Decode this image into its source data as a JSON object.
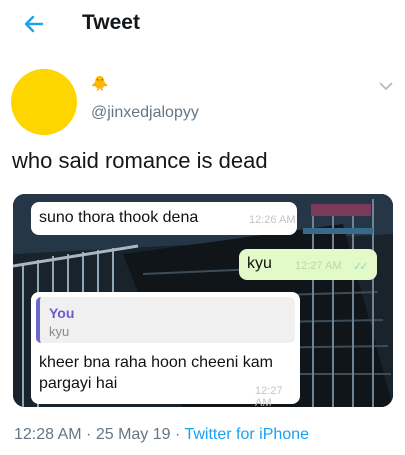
{
  "header": {
    "title": "Tweet"
  },
  "tweet": {
    "display_name_emoji": "🐥",
    "handle": "@jinxedjalopyy",
    "text": "who said romance is dead",
    "timestamp": "12:28 AM · 25 May 19 · ",
    "source": "Twitter for iPhone"
  },
  "chat": {
    "message1": {
      "text": "suno thora thook dena",
      "time": "12:26 AM"
    },
    "message2": {
      "text": "kyu",
      "time": "12:27 AM",
      "ticks": "✓✓"
    },
    "message3": {
      "quoted_name": "You",
      "quoted_text": "kyu",
      "text": "kheer bna raha hoon cheeni kam pargayi hai",
      "time": "12:27 AM"
    }
  },
  "colors": {
    "accent": "#1da1f2",
    "avatar": "#ffd500",
    "outgoing_bubble": "#e2fac7",
    "reply_bar": "#6a6ac8"
  }
}
